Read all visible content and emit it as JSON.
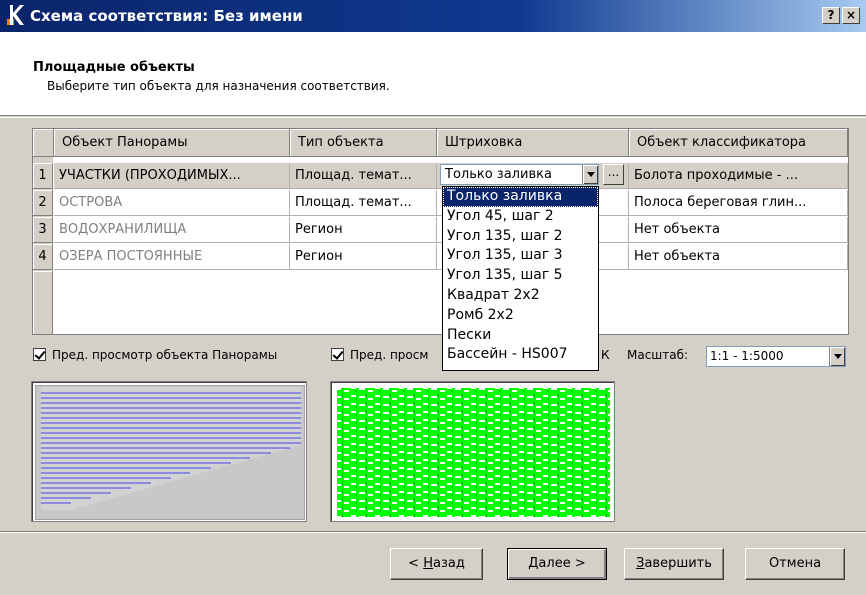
{
  "window": {
    "title": "Схема соответствия: Без имени",
    "help_button": "?",
    "close_button": "×"
  },
  "header": {
    "title": "Площадные объекты",
    "subtitle": "Выберите тип объекта для назначения соответствия."
  },
  "grid": {
    "columns": [
      "Объект Панорамы",
      "Тип объекта",
      "Штриховка",
      "Объект классификатора"
    ],
    "rows": [
      {
        "num": "1",
        "object": "УЧАСТКИ (ПРОХОДИМЫХ...",
        "type": "Площад. темат...",
        "hatch": "Только заливка",
        "classifier": "Болота проходимые - ..."
      },
      {
        "num": "2",
        "object": "ОСТРОВА",
        "type": "Площад. темат...",
        "hatch": "",
        "classifier": "Полоса береговая глин..."
      },
      {
        "num": "3",
        "object": "ВОДОХРАНИЛИЩА",
        "type": "Регион",
        "hatch": "",
        "classifier": "Нет объекта"
      },
      {
        "num": "4",
        "object": "ОЗЕРА ПОСТОЯННЫЕ",
        "type": "Регион",
        "hatch": "",
        "classifier": "Нет объекта"
      }
    ],
    "ellipsis": "..."
  },
  "hatch_dropdown": {
    "selected": "Только заливка",
    "options": [
      "Только заливка",
      "Угол 45, шаг 2",
      "Угол 135, шаг 2",
      "Угол 135, шаг 3",
      "Угол 135, шаг 5",
      "Квадрат 2х2",
      "Ромб 2х2",
      "Пески",
      "Бассейн - HS007"
    ]
  },
  "options": {
    "preview_panorama": "Пред. просмотр объекта Панорамы",
    "preview_classifier_visible": "Пред. просм",
    "trailing_letter": "К",
    "scale_label": "Масштаб:",
    "scale_value": "1:1 - 1:5000"
  },
  "buttons": {
    "back_prefix": "< ",
    "back_ul": "Н",
    "back_rest": "азад",
    "next_ul": "Д",
    "next_rest": "алее >",
    "finish_ul": "З",
    "finish_rest": "авершить",
    "cancel": "Отмена"
  },
  "colors": {
    "titlebar": "#0a246a",
    "preview_lines": "#4040e0",
    "preview_green": "#00ff00",
    "selection": "#0a246a"
  }
}
